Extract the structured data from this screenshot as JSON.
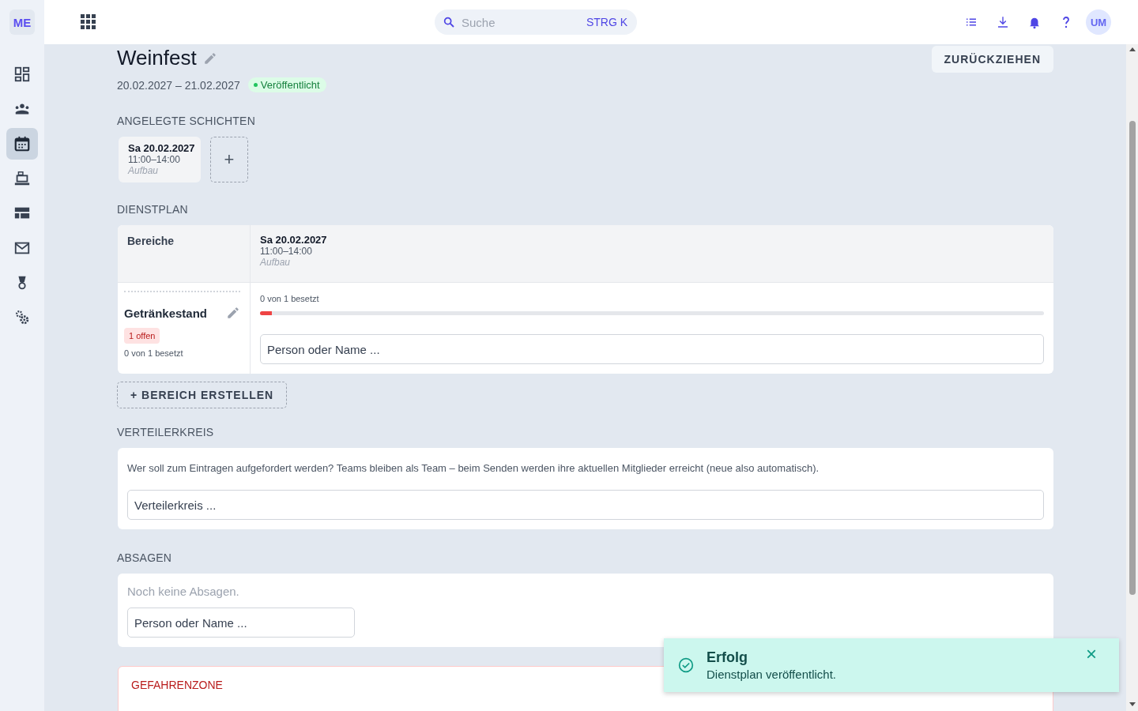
{
  "sidebar": {
    "badge": "ME",
    "items": [
      {
        "selected": false
      },
      {
        "selected": false
      },
      {
        "selected": true
      },
      {
        "selected": false
      },
      {
        "selected": false
      },
      {
        "selected": false
      },
      {
        "selected": false
      },
      {
        "selected": false
      }
    ]
  },
  "topbar": {
    "search": {
      "placeholder": "Suche",
      "shortcut": "STRG K"
    },
    "avatar": "UM"
  },
  "event": {
    "title": "Weinfest",
    "dates": "20.02.2027 – 21.02.2027",
    "status": "Veröffentlicht",
    "action": "ZURÜCKZIEHEN"
  },
  "shifts": {
    "heading": "ANGELEGTE SCHICHTEN",
    "items": [
      {
        "day": "Sa 20.02.2027",
        "time": "11:00–14:00",
        "label": "Aufbau"
      }
    ],
    "add": "+"
  },
  "roster": {
    "heading": "DIENSTPLAN",
    "corner": "Bereiche",
    "columns": [
      {
        "day": "Sa 20.02.2027",
        "time": "11:00–14:00",
        "label": "Aufbau"
      }
    ],
    "areas": [
      {
        "name": "Getränkestand",
        "badge": "1 offen",
        "summary": "0 von 1 besetzt",
        "cells": [
          {
            "filled": "0 von 1 besetzt",
            "level": 0.015,
            "placeholder": "Person oder Name ..."
          }
        ]
      }
    ],
    "create": "+ BEREICH ERSTELLEN"
  },
  "distribution": {
    "heading": "VERTEILERKREIS",
    "hint": "Wer soll zum Eintragen aufgefordert werden? Teams bleiben als Team – beim Senden werden ihre aktuellen Mitglieder erreicht (neue also automatisch).",
    "placeholder": "Verteilerkreis ..."
  },
  "cancellations": {
    "heading": "ABSAGEN",
    "empty": "Noch keine Absagen.",
    "placeholder": "Person oder Name ..."
  },
  "danger": {
    "heading": "GEFAHRENZONE"
  },
  "toast": {
    "title": "Erfolg",
    "message": "Dienstplan veröffentlicht.",
    "close": "×"
  }
}
